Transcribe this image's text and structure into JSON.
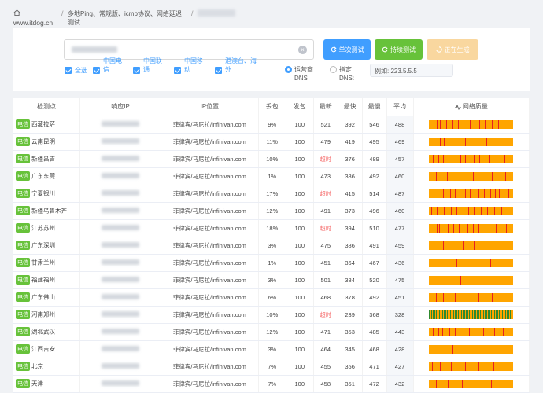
{
  "breadcrumb": {
    "site": "www.itdog.cn",
    "title": "多地Ping、常规版、icmp协议、网络延迟测试"
  },
  "form": {
    "clear_symbol": "×",
    "buttons": {
      "single": "单次测试",
      "continuous": "持续测试",
      "generating": "正在生成"
    },
    "isp_options": [
      {
        "label": "全选",
        "checked": true
      },
      {
        "label": "中国电信",
        "checked": true
      },
      {
        "label": "中国联通",
        "checked": true
      },
      {
        "label": "中国移动",
        "checked": true
      },
      {
        "label": "港澳台、海外",
        "checked": true
      }
    ],
    "dns": {
      "operator_label": "运营商DNS",
      "custom_label": "指定DNS:",
      "example": "例如: 223.5.5.5",
      "selected": "operator"
    }
  },
  "table": {
    "headers": [
      "检测点",
      "响应IP",
      "IP位置",
      "丢包",
      "发包",
      "最新",
      "最快",
      "最慢",
      "平均",
      "网络质量"
    ],
    "isp_tag": "电信",
    "rows": [
      {
        "node": "西藏拉萨",
        "location": "菲律宾/马尼拉/infinivan.com",
        "loss": "9%",
        "sent": "100",
        "latest": "521",
        "fastest": "392",
        "slowest": "546",
        "avg": "488"
      },
      {
        "node": "云南昆明",
        "location": "菲律宾/马尼拉/infinivan.com",
        "loss": "11%",
        "sent": "100",
        "latest": "479",
        "fastest": "419",
        "slowest": "495",
        "avg": "469"
      },
      {
        "node": "新疆昌吉",
        "location": "菲律宾/马尼拉/infinivan.com",
        "loss": "10%",
        "sent": "100",
        "latest": "超时",
        "fastest": "376",
        "slowest": "489",
        "avg": "457"
      },
      {
        "node": "广东东莞",
        "location": "菲律宾/马尼拉/infinivan.com",
        "loss": "1%",
        "sent": "100",
        "latest": "473",
        "fastest": "386",
        "slowest": "492",
        "avg": "460"
      },
      {
        "node": "宁夏银川",
        "location": "菲律宾/马尼拉/infinivan.com",
        "loss": "17%",
        "sent": "100",
        "latest": "超时",
        "fastest": "415",
        "slowest": "514",
        "avg": "487"
      },
      {
        "node": "新疆乌鲁木齐",
        "location": "菲律宾/马尼拉/infinivan.com",
        "loss": "12%",
        "sent": "100",
        "latest": "491",
        "fastest": "373",
        "slowest": "496",
        "avg": "460"
      },
      {
        "node": "江苏苏州",
        "location": "菲律宾/马尼拉/infinivan.com",
        "loss": "18%",
        "sent": "100",
        "latest": "超时",
        "fastest": "394",
        "slowest": "510",
        "avg": "477"
      },
      {
        "node": "广东深圳",
        "location": "菲律宾/马尼拉/infinivan.com",
        "loss": "3%",
        "sent": "100",
        "latest": "475",
        "fastest": "386",
        "slowest": "491",
        "avg": "459"
      },
      {
        "node": "甘肃兰州",
        "location": "菲律宾/马尼拉/infinivan.com",
        "loss": "1%",
        "sent": "100",
        "latest": "451",
        "fastest": "364",
        "slowest": "467",
        "avg": "436"
      },
      {
        "node": "福建福州",
        "location": "菲律宾/马尼拉/infinivan.com",
        "loss": "3%",
        "sent": "100",
        "latest": "501",
        "fastest": "384",
        "slowest": "520",
        "avg": "475"
      },
      {
        "node": "广东佛山",
        "location": "菲律宾/马尼拉/infinivan.com",
        "loss": "6%",
        "sent": "100",
        "latest": "468",
        "fastest": "378",
        "slowest": "492",
        "avg": "451"
      },
      {
        "node": "河南郑州",
        "location": "菲律宾/马尼拉/infinivan.com",
        "loss": "10%",
        "sent": "100",
        "latest": "超时",
        "fastest": "239",
        "slowest": "368",
        "avg": "328"
      },
      {
        "node": "湖北武汉",
        "location": "菲律宾/马尼拉/infinivan.com",
        "loss": "12%",
        "sent": "100",
        "latest": "471",
        "fastest": "353",
        "slowest": "485",
        "avg": "443"
      },
      {
        "node": "江西吉安",
        "location": "菲律宾/马尼拉/infinivan.com",
        "loss": "3%",
        "sent": "100",
        "latest": "464",
        "fastest": "345",
        "slowest": "468",
        "avg": "428"
      },
      {
        "node": "北京",
        "location": "菲律宾/马尼拉/infinivan.com",
        "loss": "7%",
        "sent": "100",
        "latest": "455",
        "fastest": "356",
        "slowest": "471",
        "avg": "427"
      },
      {
        "node": "天津",
        "location": "菲律宾/马尼拉/infinivan.com",
        "loss": "7%",
        "sent": "100",
        "latest": "458",
        "fastest": "351",
        "slowest": "472",
        "avg": "432"
      }
    ]
  },
  "colors": {
    "primary": "#409eff",
    "success": "#67c23a",
    "warning": "#f9d79f",
    "bar_base": "#ffa500",
    "bar_loss": "#e62020",
    "timeout": "#f56c6c"
  }
}
